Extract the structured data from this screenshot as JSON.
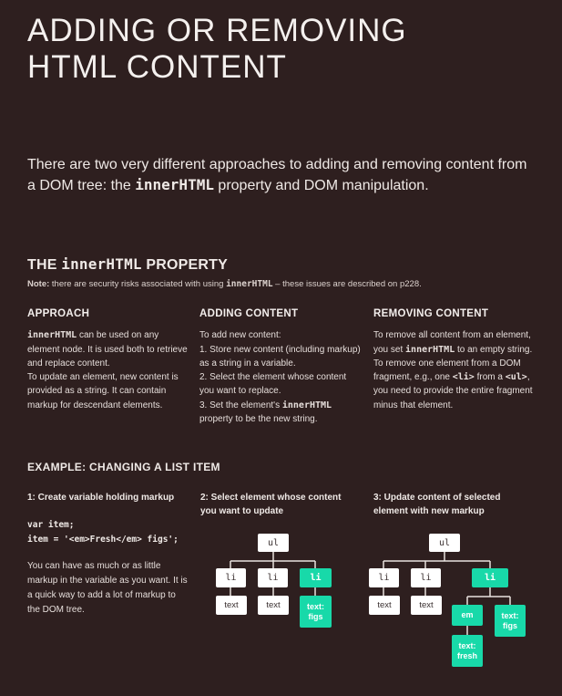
{
  "title_line1": "ADDING OR REMOVING",
  "title_line2": "HTML CONTENT",
  "intro": {
    "before": "There are two very different approaches to adding and removing content from a DOM tree: the ",
    "code": "innerHTML",
    "after": " property and DOM manipulation."
  },
  "property_heading": {
    "the": "THE ",
    "code": "innerHTML",
    "rest": " PROPERTY"
  },
  "note": {
    "label": "Note:",
    "before": " there are security risks associated with using ",
    "code": "innerHTML",
    "after": " – these issues are described on p228."
  },
  "approach": {
    "heading": "APPROACH",
    "code": "innerHTML",
    "text1": " can be used on any element node. It is used both to retrieve and replace content.",
    "text2": "To update an element, new content is provided as a string. It can contain markup for descendant elements."
  },
  "adding": {
    "heading": "ADDING CONTENT",
    "line0": "To add new content:",
    "line1": "1. Store new content (including markup) as a string in a variable.",
    "line2": "2. Select the element whose content you want to replace.",
    "line3a": "3. Set the element's ",
    "line3code": "innerHTML",
    "line3b": " property to be the new string."
  },
  "removing": {
    "heading": "REMOVING CONTENT",
    "t1": "To remove all content from an element, you set ",
    "code1": "innerHTML",
    "t2": " to an empty string. To remove one element from a DOM fragment, e.g., one ",
    "code2": "<li>",
    "t3": " from a ",
    "code3": "<ul>",
    "t4": ", you need to provide the entire fragment minus that element."
  },
  "example_heading": "EXAMPLE: CHANGING A LIST ITEM",
  "step1": "1: Create variable holding markup",
  "step2": "2: Select element whose content you want to update",
  "step3": "3: Update content of selected element with new markup",
  "code_line1": "var item;",
  "code_line2": "item = '<em>Fresh</em> figs';",
  "description": "You can have as much or as little markup in the variable as you want. It is a quick way to add a lot of markup to the DOM tree.",
  "tree": {
    "ul": "ul",
    "li": "li",
    "text": "text",
    "text_figs_1": "text:",
    "text_figs_2": "figs",
    "em": "em",
    "text_fresh_1": "text:",
    "text_fresh_2": "fresh",
    "colors": {
      "green": "#18d9a9",
      "white": "#ffffff",
      "line": "#e8e2df"
    }
  }
}
